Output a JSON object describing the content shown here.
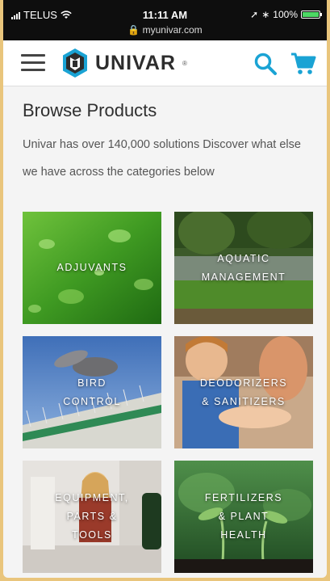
{
  "status_bar": {
    "carrier": "TELUS",
    "time": "11:11 AM",
    "url": "myunivar.com",
    "battery_percent": "100%",
    "battery_level": 1.0
  },
  "header": {
    "brand": "UNIVAR",
    "brand_mark": "®",
    "accent_color": "#1aa3d4",
    "icons": [
      "hamburger-menu-icon",
      "search-icon",
      "cart-icon"
    ]
  },
  "main": {
    "title": "Browse Products",
    "description": "Univar has over 140,000 solutions  Discover what else we have across the categories below",
    "categories": [
      {
        "label": "ADJUVANTS"
      },
      {
        "label": "AQUATIC\nMANAGEMENT"
      },
      {
        "label": "BIRD\nCONTROL"
      },
      {
        "label": "DEODORIZERS\n& SANITIZERS"
      },
      {
        "label": "EQUIPMENT,\nPARTS &\nTOOLS"
      },
      {
        "label": "FERTILIZERS\n& PLANT\nHEALTH"
      }
    ]
  }
}
